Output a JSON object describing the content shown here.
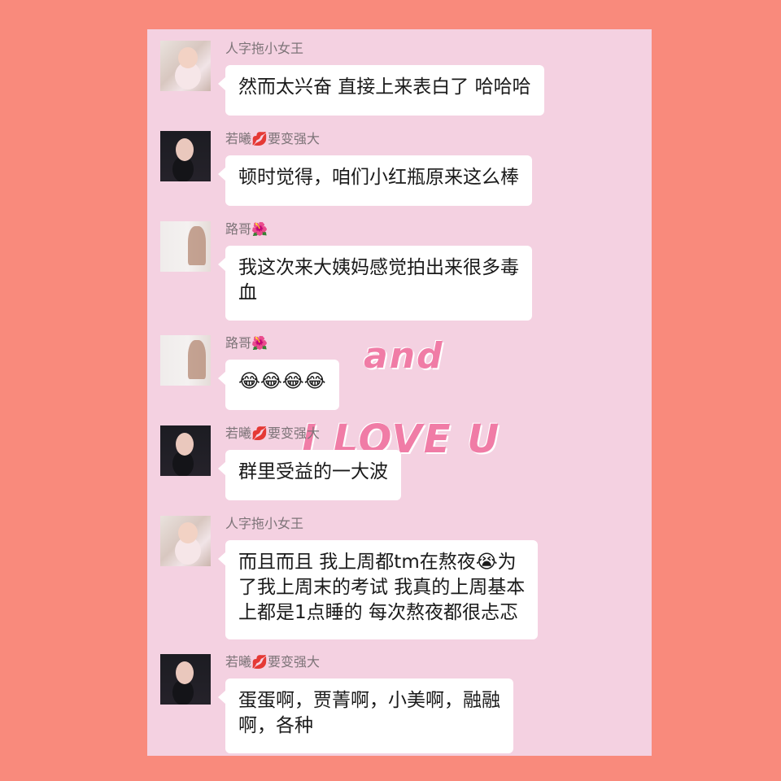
{
  "watermark": {
    "and": "and",
    "love": "I LOVE U"
  },
  "messages": [
    {
      "avatar": "avatar-woman-white-room",
      "name": "人字拖小女王",
      "lines": [
        "然而太兴奋 直接上来表白了 哈哈哈"
      ]
    },
    {
      "avatar": "avatar-woman-dark-dress",
      "name": "若曦",
      "name_emoji": "💋",
      "name_suffix": "要变强大",
      "lines": [
        "顿时觉得，咱们小红瓶原来这么棒"
      ]
    },
    {
      "avatar": "avatar-woman-mirror-selfie",
      "name": "路哥",
      "name_emoji": "🌺",
      "lines": [
        "我这次来大姨妈感觉拍出来很多毒",
        "血"
      ]
    },
    {
      "avatar": "avatar-woman-mirror-selfie",
      "name": "路哥",
      "name_emoji": "🌺",
      "lines": [
        "😂😂😂😂"
      ]
    },
    {
      "avatar": "avatar-woman-dark-dress",
      "name": "若曦",
      "name_emoji": "💋",
      "name_suffix": "要变强大",
      "lines": [
        "群里受益的一大波"
      ]
    },
    {
      "avatar": "avatar-woman-white-room",
      "name": "人字拖小女王",
      "lines": [
        "而且而且 我上周都tm在熬夜😭为",
        "了我上周末的考试 我真的上周基本",
        "上都是1点睡的 每次熬夜都很忐忑"
      ]
    },
    {
      "avatar": "avatar-woman-dark-dress",
      "name": "若曦",
      "name_emoji": "💋",
      "name_suffix": "要变强大",
      "lines": [
        "蛋蛋啊，贾菁啊，小美啊，融融",
        "啊，各种"
      ]
    }
  ]
}
